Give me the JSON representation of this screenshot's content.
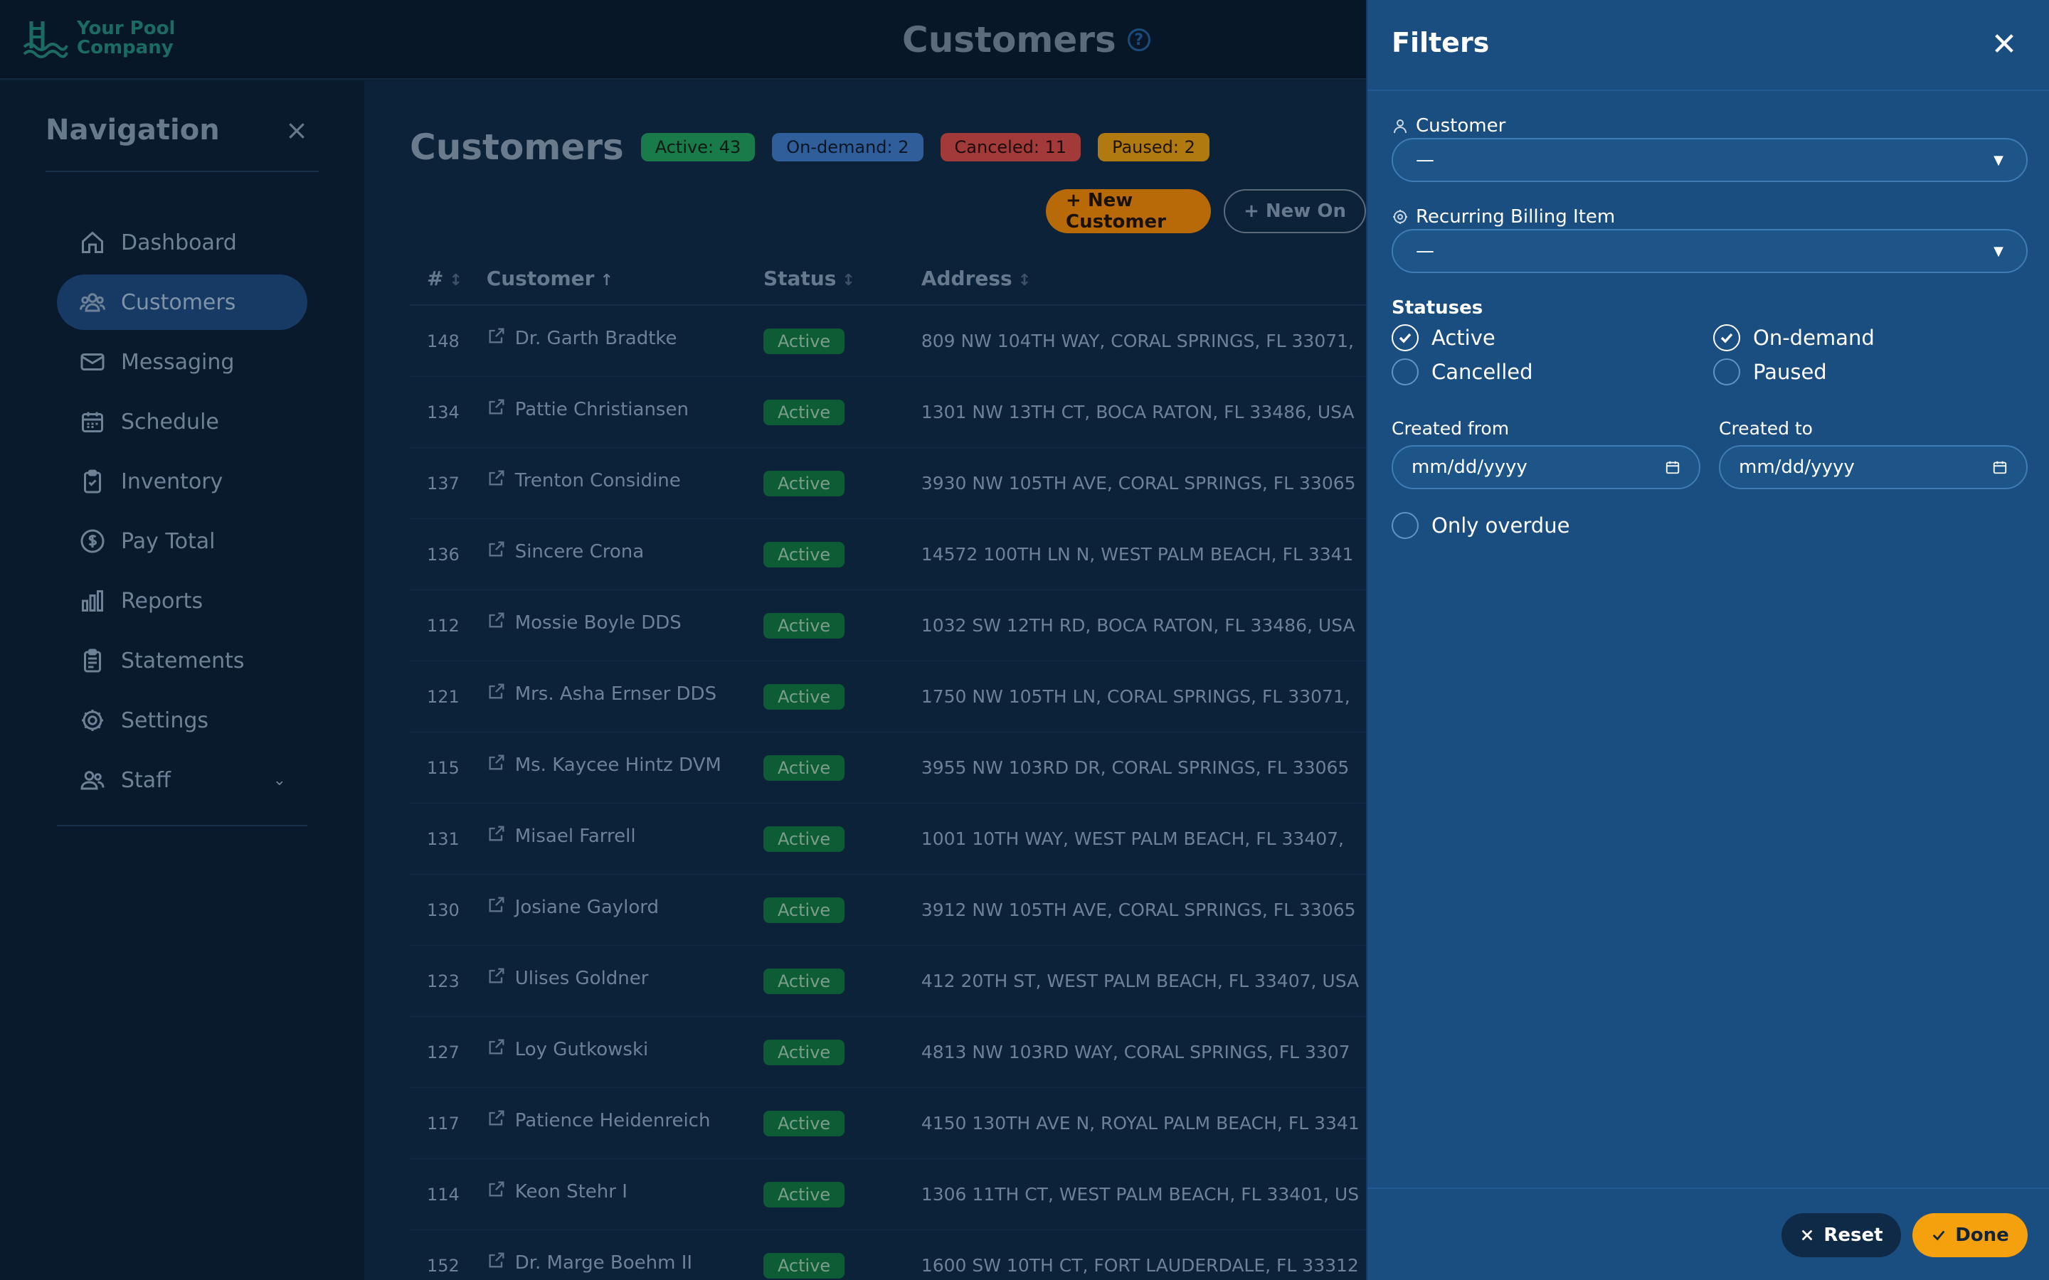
{
  "brand": {
    "line1": "Your Pool",
    "line2": "Company",
    "color": "#1b6b63"
  },
  "header": {
    "title": "Customers"
  },
  "navigation": {
    "title": "Navigation",
    "items": [
      {
        "label": "Dashboard",
        "icon": "home-icon",
        "active": false
      },
      {
        "label": "Customers",
        "icon": "users-icon",
        "active": true
      },
      {
        "label": "Messaging",
        "icon": "mail-icon",
        "active": false
      },
      {
        "label": "Schedule",
        "icon": "calendar-icon",
        "active": false
      },
      {
        "label": "Inventory",
        "icon": "clipboard-icon",
        "active": false
      },
      {
        "label": "Pay Total",
        "icon": "dollar-icon",
        "active": false
      },
      {
        "label": "Reports",
        "icon": "bar-chart-icon",
        "active": false
      },
      {
        "label": "Statements",
        "icon": "statements-icon",
        "active": false
      },
      {
        "label": "Settings",
        "icon": "gear-icon",
        "active": false
      },
      {
        "label": "Staff",
        "icon": "staff-icon",
        "active": false
      }
    ]
  },
  "page": {
    "title": "Customers",
    "badges": {
      "active": "Active: 43",
      "ondemand": "On-demand: 2",
      "canceled": "Canceled: 11",
      "paused": "Paused: 2"
    },
    "new_customer_label": "+ New Customer",
    "new_other_label": "+ New On"
  },
  "table": {
    "columns": {
      "num": "#",
      "customer": "Customer",
      "status": "Status",
      "address": "Address"
    },
    "rows": [
      {
        "num": "148",
        "name": "Dr. Garth Bradtke",
        "status": "Active",
        "address": "809 NW 104TH WAY, CORAL SPRINGS, FL 33071,"
      },
      {
        "num": "134",
        "name": "Pattie Christiansen",
        "status": "Active",
        "address": "1301 NW 13TH CT, BOCA RATON, FL 33486, USA"
      },
      {
        "num": "137",
        "name": "Trenton Considine",
        "status": "Active",
        "address": "3930 NW 105TH AVE, CORAL SPRINGS, FL 33065"
      },
      {
        "num": "136",
        "name": "Sincere Crona",
        "status": "Active",
        "address": "14572 100TH LN N, WEST PALM BEACH, FL 3341"
      },
      {
        "num": "112",
        "name": "Mossie Boyle DDS",
        "status": "Active",
        "address": "1032 SW 12TH RD, BOCA RATON, FL 33486, USA"
      },
      {
        "num": "121",
        "name": "Mrs. Asha Ernser DDS",
        "status": "Active",
        "address": "1750 NW 105TH LN, CORAL SPRINGS, FL 33071,"
      },
      {
        "num": "115",
        "name": "Ms. Kaycee Hintz DVM",
        "status": "Active",
        "address": "3955 NW 103RD DR, CORAL SPRINGS, FL 33065"
      },
      {
        "num": "131",
        "name": "Misael Farrell",
        "status": "Active",
        "address": "1001 10TH WAY, WEST PALM BEACH, FL 33407,"
      },
      {
        "num": "130",
        "name": "Josiane Gaylord",
        "status": "Active",
        "address": "3912 NW 105TH AVE, CORAL SPRINGS, FL 33065"
      },
      {
        "num": "123",
        "name": "Ulises Goldner",
        "status": "Active",
        "address": "412 20TH ST, WEST PALM BEACH, FL 33407, USA"
      },
      {
        "num": "127",
        "name": "Loy Gutkowski",
        "status": "Active",
        "address": "4813 NW 103RD WAY, CORAL SPRINGS, FL 3307"
      },
      {
        "num": "117",
        "name": "Patience Heidenreich",
        "status": "Active",
        "address": "4150 130TH AVE N, ROYAL PALM BEACH, FL 3341"
      },
      {
        "num": "114",
        "name": "Keon Stehr I",
        "status": "Active",
        "address": "1306 11TH CT, WEST PALM BEACH, FL 33401, US"
      },
      {
        "num": "152",
        "name": "Dr. Marge Boehm II",
        "status": "Active",
        "address": "1600 SW 10TH CT, FORT LAUDERDALE, FL 33312"
      }
    ]
  },
  "filters": {
    "title": "Filters",
    "customer_label": "Customer",
    "customer_value": "—",
    "billing_label": "Recurring Billing Item",
    "billing_value": "—",
    "statuses_label": "Statuses",
    "statuses": {
      "active": {
        "label": "Active",
        "checked": true
      },
      "ondemand": {
        "label": "On-demand",
        "checked": true
      },
      "cancelled": {
        "label": "Cancelled",
        "checked": false
      },
      "paused": {
        "label": "Paused",
        "checked": false
      }
    },
    "created_from_label": "Created from",
    "created_from_placeholder": "mm/dd/yyyy",
    "created_to_label": "Created to",
    "created_to_placeholder": "mm/dd/yyyy",
    "overdue_label": "Only overdue",
    "reset_label": "Reset",
    "done_label": "Done"
  }
}
